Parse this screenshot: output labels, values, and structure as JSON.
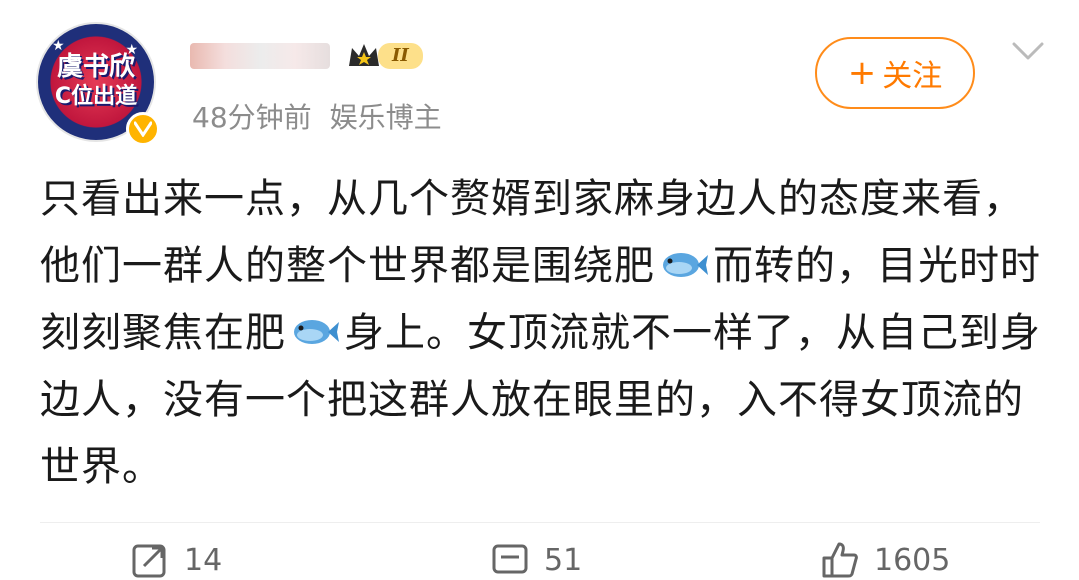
{
  "post": {
    "author": {
      "avatar_text_line1": "虞书欣",
      "avatar_text_line2": "C位出道",
      "verified_mark": "v",
      "rank_label": "II"
    },
    "time": "48分钟前",
    "category": "娱乐博主",
    "follow_label": "关注",
    "body": "只看出来一点，从几个赘婿到家麻身边人的态度来看，他们一群人的整个世界都是围绕肥🐟而转的，目光时时刻刻聚焦在肥🐟身上。女顶流就不一样了，从自己到身边人，没有一个把这群人放在眼里的，入不得女顶流的世界。",
    "body_parts": [
      "只看出来一点，从几个赘婿到家麻身边人的态度来看，他们一群人的整个世界都是围绕肥",
      "而转的，目光时时刻刻聚焦在肥",
      "身上。女顶流就不一样了，从自己到身边人，没有一个把这群人放在眼里的，入不得女顶流的世界。"
    ],
    "actions": {
      "repost_count": "14",
      "comment_count": "51",
      "like_count": "1605"
    }
  },
  "colors": {
    "follow_accent": "#ff7a00",
    "meta_gray": "#8c8c8c",
    "verified_gold": "#ffb400"
  },
  "icons": {
    "follow": "plus-icon",
    "menu": "chevron-down-icon",
    "inline_emoji": "fish-icon",
    "repost": "repost-icon",
    "comment": "comment-icon",
    "like": "thumbs-up-icon"
  }
}
